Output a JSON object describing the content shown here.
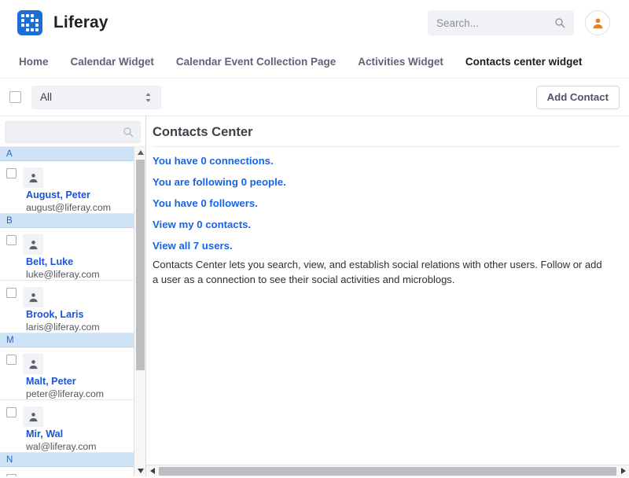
{
  "header": {
    "brand_name": "Liferay",
    "logo_icon": "liferay-logo-icon",
    "search": {
      "placeholder": "Search...",
      "value": "",
      "icon": "search-icon"
    },
    "avatar": {
      "icon": "user-avatar-icon",
      "color": "#e8821e"
    }
  },
  "nav": {
    "items": [
      {
        "label": "Home",
        "active": false
      },
      {
        "label": "Calendar Widget",
        "active": false
      },
      {
        "label": "Calendar Event Collection Page",
        "active": false
      },
      {
        "label": "Activities Widget",
        "active": false
      },
      {
        "label": "Contacts center widget",
        "active": true
      }
    ]
  },
  "toolbar": {
    "select_all_checkbox": "",
    "filter_value": "All",
    "filter_icon": "chevron-updown-icon",
    "add_contact_label": "Add Contact"
  },
  "list_panel": {
    "search": {
      "placeholder": "",
      "value": "",
      "icon": "search-icon"
    },
    "groups": [
      {
        "letter": "A",
        "contacts": [
          {
            "name": "August, Peter",
            "email": "august@liferay.com"
          }
        ]
      },
      {
        "letter": "B",
        "contacts": [
          {
            "name": "Belt, Luke",
            "email": "luke@liferay.com"
          },
          {
            "name": "Brook, Laris",
            "email": "laris@liferay.com"
          }
        ]
      },
      {
        "letter": "M",
        "contacts": [
          {
            "name": "Malt, Peter",
            "email": "peter@liferay.com"
          },
          {
            "name": "Mir, Wal",
            "email": "wal@liferay.com"
          }
        ]
      },
      {
        "letter": "N",
        "contacts": []
      }
    ],
    "scrollbar": {
      "up_icon": "scroll-up-arrow-icon",
      "down_icon": "scroll-down-arrow-icon"
    }
  },
  "content": {
    "title": "Contacts Center",
    "links": [
      "You have 0 connections.",
      "You are following 0 people.",
      "You have 0 followers.",
      "View my 0 contacts.",
      "View all 7 users."
    ],
    "description": "Contacts Center lets you search, view, and establish social relations with other users. Follow or add a user as a connection to see their social activities and microblogs.",
    "scrollbar": {
      "left_icon": "scroll-left-arrow-icon",
      "right_icon": "scroll-right-arrow-icon"
    }
  },
  "colors": {
    "brand_blue": "#1b6ed8",
    "link_blue": "#1764e8",
    "group_header_bg": "#cfe3f7",
    "avatar_orange": "#e8821e"
  }
}
